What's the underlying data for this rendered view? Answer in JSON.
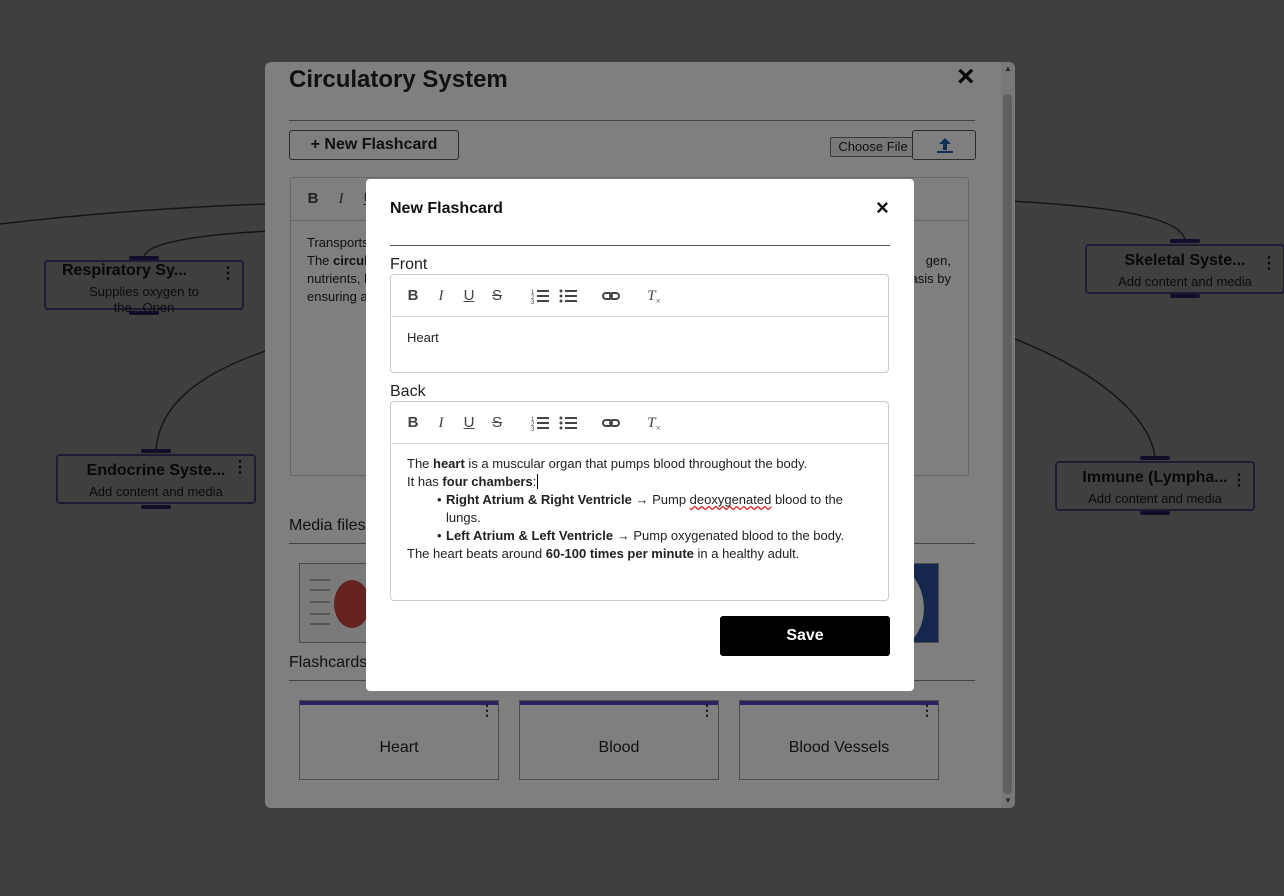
{
  "mindmap": {
    "nodes": [
      {
        "title": "Respiratory Sy...",
        "subtitle": "Supplies oxygen to the...Open"
      },
      {
        "title": "Endocrine Syste...",
        "subtitle": "Add content and media"
      },
      {
        "title": "Skeletal Syste...",
        "subtitle": "Add content and media"
      },
      {
        "title": "Immune (Lympha...",
        "subtitle": "Add content and media"
      }
    ]
  },
  "panel": {
    "title": "Circulatory System",
    "close_icon": "×",
    "new_flashcard_label": "+ New Flashcard",
    "choose_file_label": "Choose File",
    "upload_icon": "upload-icon",
    "editor_text_line1": "Transports",
    "editor_text_line2_a": "The ",
    "editor_text_line2_b": "circul",
    "editor_text_line2_right": "gen,",
    "editor_text_line3_a": "nutrients, h",
    "editor_text_line3_right": "asis by",
    "editor_text_line4": "ensuring a",
    "media_files_label": "Media files",
    "flashcards_label": "Flashcards",
    "flashcards": [
      "Heart",
      "Blood",
      "Blood Vessels"
    ]
  },
  "dialog": {
    "title": "New Flashcard",
    "close_icon": "×",
    "front_label": "Front",
    "back_label": "Back",
    "front_text": "Heart",
    "back": {
      "p1_a": "The ",
      "p1_b": "heart",
      "p1_c": " is a muscular organ that pumps blood throughout the body.",
      "p2_a": "It has ",
      "p2_b": "four chambers",
      "p2_c": ":",
      "li1_b": "Right Atrium & Right Ventricle",
      "li1_c": " → Pump ",
      "li1_d": "deoxygenated",
      "li1_e": " blood to the lungs.",
      "li2_b": "Left Atrium & Left Ventricle",
      "li2_c": " → Pump oxygenated blood to the body.",
      "p3_a": "The heart beats around ",
      "p3_b": "60-100 times per minute",
      "p3_c": " in a healthy adult."
    },
    "save_label": "Save"
  },
  "colors": {
    "accent": "#5a3fc0",
    "overlay": "rgba(0,0,0,0.5)",
    "save_bg": "#000000"
  }
}
